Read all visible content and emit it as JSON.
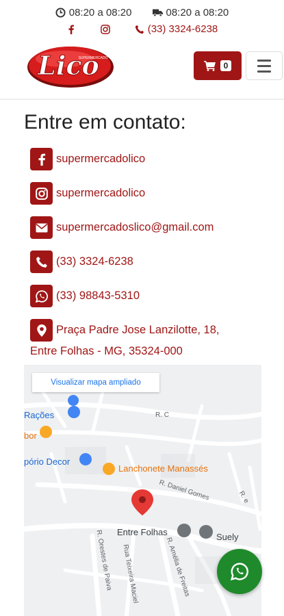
{
  "topbar": {
    "hours_open": "08:20 a 08:20",
    "hours_delivery": "08:20 a 08:20",
    "phone": "(33) 3324-6238"
  },
  "header": {
    "logo_text": "Lico",
    "logo_subtext": "SUPERMERCADO",
    "cart_count": "0"
  },
  "contact": {
    "title": "Entre em contato:",
    "items": [
      {
        "icon": "facebook-icon",
        "text": "supermercadolico"
      },
      {
        "icon": "instagram-icon",
        "text": "supermercadolico"
      },
      {
        "icon": "envelope-icon",
        "text": "supermercadoslico@gmail.com"
      },
      {
        "icon": "phone-icon",
        "text": "(33) 3324-6238"
      },
      {
        "icon": "whatsapp-icon",
        "text": "(33) 98843-5310"
      }
    ],
    "address_line1": "Praça Padre Jose Lanzilotte, 18,",
    "address_line2": "Entre Folhas - MG, 35324-000"
  },
  "map": {
    "view_larger": "Visualizar mapa ampliado",
    "places": {
      "racoes": "Rações",
      "bor": "bor",
      "decor": "pório Decor",
      "lanchonete": "Lanchonete Manassés",
      "entre_folhas": "Entre Folhas",
      "suely": "Suely"
    },
    "roads": {
      "rc": "R. C",
      "daniel": "R. Daniel Gomes",
      "orestes": "R. Orestes de Paiva",
      "teixeira": "Rua Teixeira Maciel",
      "amelia": "R. Amélia de Freitas",
      "re": "R. e"
    }
  },
  "colors": {
    "brand": "#a01616",
    "whatsapp": "#1f8a2b"
  }
}
